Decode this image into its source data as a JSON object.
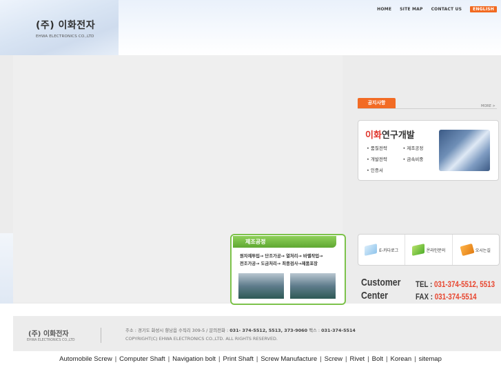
{
  "header": {
    "logo_kor": "(주) 이화전자",
    "logo_eng": "EHWA ELECTRONICS CO.,LTD",
    "nav": [
      "HOME",
      "SITE MAP",
      "CONTACT US"
    ],
    "english": "ENGLISH"
  },
  "notice": {
    "tab": "공지사항",
    "more": "MORE >"
  },
  "rnd": {
    "title_red": "이화",
    "title_rest": "연구개발",
    "items": [
      "품질전략",
      "제조공정",
      "개발전략",
      "금속비중",
      "인증서"
    ]
  },
  "quick": [
    {
      "icon": "catalog-book-icon",
      "label": "E-카다로그"
    },
    {
      "icon": "online-inquiry-icon",
      "label": "온라인문의"
    },
    {
      "icon": "directions-icon",
      "label": "오시는길"
    }
  ],
  "customer": {
    "title_line1": "Customer",
    "title_line2": "Center",
    "tel_label": "TEL :",
    "tel": "031-374-5512, 5513",
    "fax_label": "FAX :",
    "fax": "031-374-5514"
  },
  "process": {
    "title": "제조공정",
    "line1": "원자재투입→ 단조가공→ 열처리→ 바렐작업→",
    "line2": "전조가공→ 도금처리→ 최종검사→제품포장"
  },
  "footer": {
    "logo_kor": "(주) 이화전자",
    "logo_eng": "EHWA ELECTRONICS CO.,LTD",
    "address": "주소 : 경기도 화성시 향남읍 수직리 309-5  /  문의전화 :",
    "phone": "031- 374-5512, 5513, 373-9060",
    "fax_label": "팩스 :",
    "fax": "031-374-5514",
    "copyright": "COPYRIGHT(C) EHWA ELECTRONICS CO.,LTD. ALL RIGHTS RESERVED."
  },
  "bottom_links": [
    "Automobile Screw",
    "Computer Shaft",
    "Navigation bolt",
    "Print Shaft",
    "Screw Manufacture",
    "Screw",
    "Rivet",
    "Bolt",
    "Korean",
    "sitemap"
  ]
}
